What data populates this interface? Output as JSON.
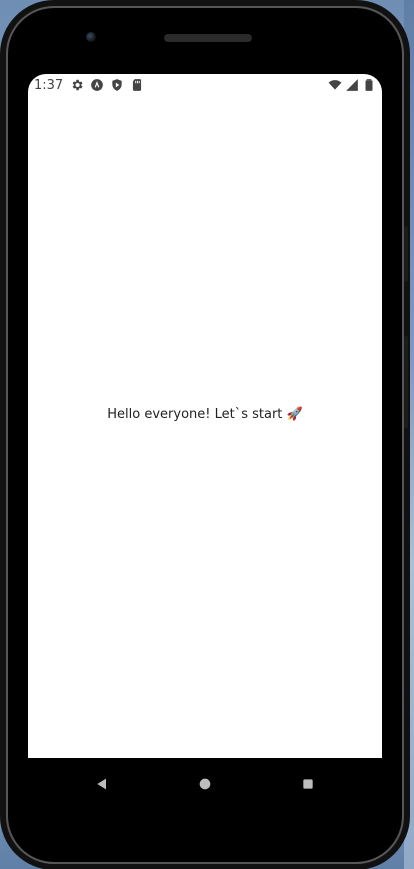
{
  "statusbar": {
    "time": "1:37",
    "left_icons": [
      "settings-icon",
      "android-icon",
      "play-protect-icon",
      "sd-card-icon"
    ],
    "right_icons": [
      "wifi-icon",
      "signal-icon",
      "battery-icon"
    ]
  },
  "app": {
    "message": "Hello everyone! Let`s start 🚀"
  },
  "navigation": {
    "buttons": [
      "back",
      "home",
      "recents"
    ]
  },
  "colors": {
    "screen_bg": "#ffffff",
    "phone_bezel": "#000000",
    "text": "#222222",
    "status_text": "#444444"
  }
}
